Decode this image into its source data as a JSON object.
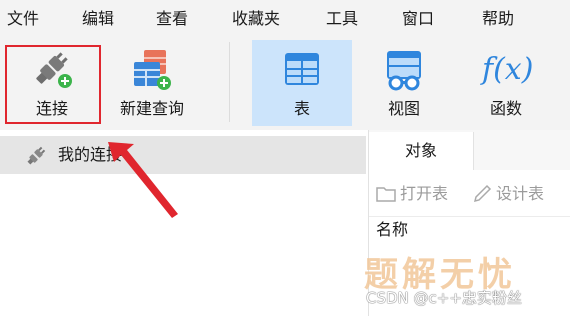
{
  "menu": [
    "文件",
    "编辑",
    "查看",
    "收藏夹",
    "工具",
    "窗口",
    "帮助"
  ],
  "toolbar": {
    "connect": "连接",
    "new_query": "新建查询",
    "table": "表",
    "view": "视图",
    "function": "函数",
    "function_glyph": "f(x)"
  },
  "sidebar": {
    "connection_name": "我的连接"
  },
  "objects": {
    "tab": "对象",
    "open_table": "打开表",
    "design_table": "设计表",
    "name_column": "名称"
  },
  "watermark": {
    "big": "题解无忧",
    "small": "CSDN @c++忠实粉丝"
  },
  "colors": {
    "highlight": "#e0262e",
    "active_tool": "#cce4fb",
    "plug_green": "#3cb44b"
  }
}
